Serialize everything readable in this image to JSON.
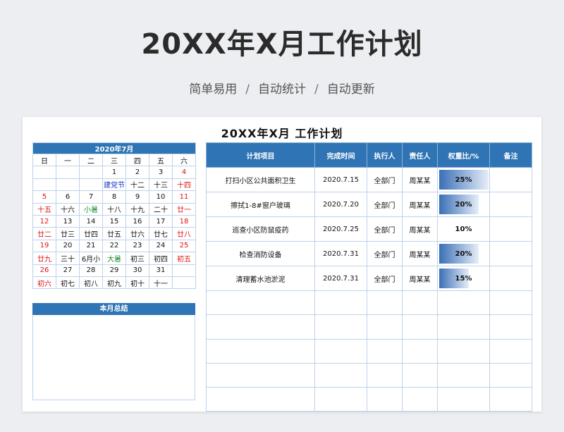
{
  "header": {
    "title": "20XX年X月工作计划",
    "subtitle_items": [
      "简单易用",
      "自动统计",
      "自动更新"
    ],
    "separator": "/"
  },
  "sheet": {
    "title": "20XX年X月 工作计划"
  },
  "calendar": {
    "title": "2020年7月",
    "weekdays": [
      "日",
      "一",
      "二",
      "三",
      "四",
      "五",
      "六"
    ],
    "rows": [
      [
        {
          "t": ""
        },
        {
          "t": ""
        },
        {
          "t": ""
        },
        {
          "t": "1"
        },
        {
          "t": "2"
        },
        {
          "t": "3"
        },
        {
          "t": "4",
          "c": "red"
        }
      ],
      [
        {
          "t": ""
        },
        {
          "t": ""
        },
        {
          "t": ""
        },
        {
          "t": "建党节",
          "c": "blue"
        },
        {
          "t": "十二"
        },
        {
          "t": "十三"
        },
        {
          "t": "十四",
          "c": "red"
        }
      ],
      [
        {
          "t": "5",
          "c": "red"
        },
        {
          "t": "6"
        },
        {
          "t": "7"
        },
        {
          "t": "8"
        },
        {
          "t": "9"
        },
        {
          "t": "10"
        },
        {
          "t": "11",
          "c": "red"
        }
      ],
      [
        {
          "t": "十五",
          "c": "red"
        },
        {
          "t": "十六"
        },
        {
          "t": "小暑",
          "c": "green"
        },
        {
          "t": "十八"
        },
        {
          "t": "十九"
        },
        {
          "t": "二十"
        },
        {
          "t": "廿一",
          "c": "red"
        }
      ],
      [
        {
          "t": "12",
          "c": "red"
        },
        {
          "t": "13"
        },
        {
          "t": "14"
        },
        {
          "t": "15"
        },
        {
          "t": "16"
        },
        {
          "t": "17"
        },
        {
          "t": "18",
          "c": "red"
        }
      ],
      [
        {
          "t": "廿二",
          "c": "red"
        },
        {
          "t": "廿三"
        },
        {
          "t": "廿四"
        },
        {
          "t": "廿五"
        },
        {
          "t": "廿六"
        },
        {
          "t": "廿七"
        },
        {
          "t": "廿八",
          "c": "red"
        }
      ],
      [
        {
          "t": "19",
          "c": "red"
        },
        {
          "t": "20"
        },
        {
          "t": "21"
        },
        {
          "t": "22"
        },
        {
          "t": "23"
        },
        {
          "t": "24"
        },
        {
          "t": "25",
          "c": "red"
        }
      ],
      [
        {
          "t": "廿九",
          "c": "red"
        },
        {
          "t": "三十"
        },
        {
          "t": "6月小"
        },
        {
          "t": "大暑",
          "c": "green"
        },
        {
          "t": "初三"
        },
        {
          "t": "初四"
        },
        {
          "t": "初五",
          "c": "red"
        }
      ],
      [
        {
          "t": "26",
          "c": "red"
        },
        {
          "t": "27"
        },
        {
          "t": "28"
        },
        {
          "t": "29"
        },
        {
          "t": "30"
        },
        {
          "t": "31"
        },
        {
          "t": ""
        }
      ],
      [
        {
          "t": "初六",
          "c": "red"
        },
        {
          "t": "初七"
        },
        {
          "t": "初八"
        },
        {
          "t": "初九"
        },
        {
          "t": "初十"
        },
        {
          "t": "十一"
        },
        {
          "t": ""
        }
      ]
    ]
  },
  "summary": {
    "title": "本月总结"
  },
  "tasks": {
    "headers": [
      "计划项目",
      "完成时间",
      "执行人",
      "责任人",
      "权重比/%",
      "备注"
    ],
    "rows": [
      {
        "item": "打扫小区公共面积卫生",
        "date": "2020.7.15",
        "executor": "全部门",
        "owner": "周某某",
        "weight": 25,
        "weight_label": "25%",
        "note": ""
      },
      {
        "item": "擦拭1-8#窗户玻璃",
        "date": "2020.7.20",
        "executor": "全部门",
        "owner": "周某某",
        "weight": 20,
        "weight_label": "20%",
        "note": ""
      },
      {
        "item": "巡查小区防鼠疫药",
        "date": "2020.7.25",
        "executor": "全部门",
        "owner": "周某某",
        "weight": 10,
        "weight_label": "10%",
        "note": ""
      },
      {
        "item": "检查消防设备",
        "date": "2020.7.31",
        "executor": "全部门",
        "owner": "周某某",
        "weight": 20,
        "weight_label": "20%",
        "note": ""
      },
      {
        "item": "清理蓄水池淤泥",
        "date": "2020.7.31",
        "executor": "全部门",
        "owner": "周某某",
        "weight": 15,
        "weight_label": "15%",
        "note": ""
      }
    ],
    "empty_rows": 5
  },
  "colors": {
    "header_blue": "#2f74b5",
    "holiday_red": "#e01010",
    "solar_term_green": "#1e8c2a",
    "festival_blue": "#1a35c8"
  }
}
